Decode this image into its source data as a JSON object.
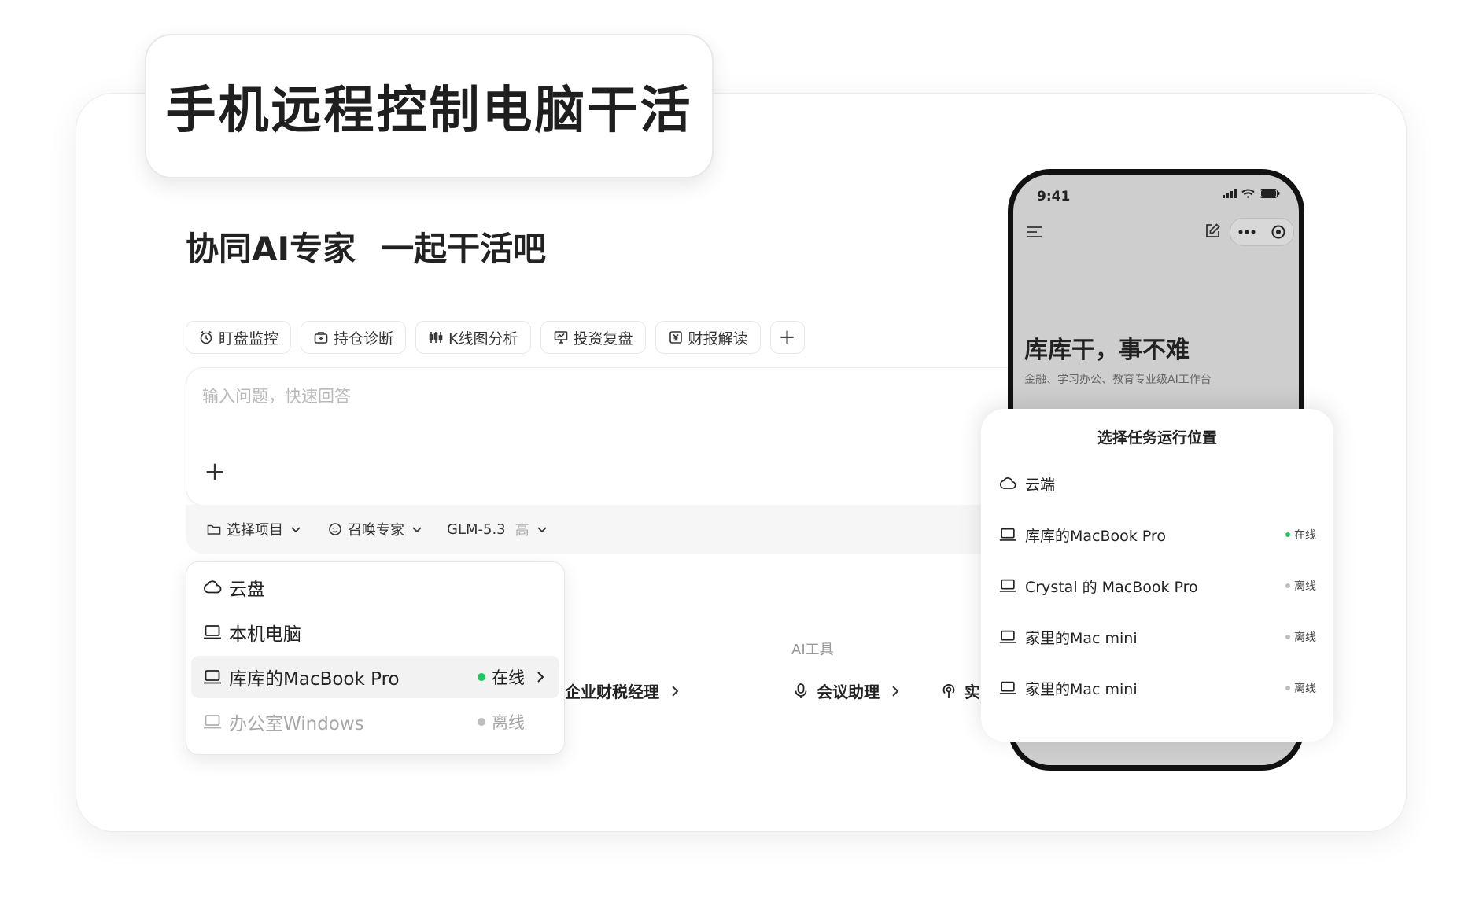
{
  "hero": {
    "title": "手机远程控制电脑干活",
    "headline_a": "协同AI专家",
    "headline_b": "一起干活吧"
  },
  "chips": [
    {
      "label": "盯盘监控",
      "icon": "alarm-clock-icon"
    },
    {
      "label": "持仓诊断",
      "icon": "briefcase-icon"
    },
    {
      "label": "K线图分析",
      "icon": "candlestick-icon"
    },
    {
      "label": "投资复盘",
      "icon": "chart-board-icon"
    },
    {
      "label": "财报解读",
      "icon": "report-icon"
    },
    {
      "label": "+",
      "icon": "plus-icon"
    }
  ],
  "composer": {
    "placeholder": "输入问题，快速回答",
    "add": "+",
    "project_label": "选择项目",
    "expert_label": "召唤专家",
    "model_label": "GLM-5.3",
    "model_level": "高"
  },
  "location_menu": {
    "items": [
      {
        "label": "云盘",
        "icon": "cloud-icon",
        "status": "",
        "status_color": ""
      },
      {
        "label": "本机电脑",
        "icon": "laptop-icon",
        "status": "",
        "status_color": ""
      },
      {
        "label": "库库的MacBook Pro",
        "icon": "laptop-icon",
        "status": "在线",
        "status_color": "#22c55e",
        "selected": true
      },
      {
        "label": "办公室Windows",
        "icon": "laptop-icon",
        "status": "离线",
        "status_color": "#bdbdbd",
        "disabled": true
      }
    ]
  },
  "tools": {
    "section_label": "AI工具",
    "partial_link": "企业财税经理",
    "meeting": "会议助理",
    "truncated": "实"
  },
  "phone": {
    "time": "9:41",
    "headline": "库库干，事不难",
    "subtitle": "金融、学习办公、教育专业级AI工作台"
  },
  "sheet": {
    "title": "选择任务运行位置",
    "items": [
      {
        "label": "云端",
        "icon": "cloud-icon",
        "status": "",
        "status_color": ""
      },
      {
        "label": "库库的MacBook Pro",
        "icon": "laptop-icon",
        "status": "在线",
        "status_color": "#22c55e"
      },
      {
        "label": "Crystal 的 MacBook Pro",
        "icon": "laptop-icon",
        "status": "离线",
        "status_color": "#bdbdbd"
      },
      {
        "label": "家里的Mac mini",
        "icon": "laptop-icon",
        "status": "离线",
        "status_color": "#bdbdbd"
      },
      {
        "label": "家里的Mac mini",
        "icon": "laptop-icon",
        "status": "离线",
        "status_color": "#bdbdbd"
      }
    ]
  },
  "colors": {
    "online": "#22c55e",
    "offline": "#bdbdbd",
    "phone_bg": "#cecece"
  }
}
